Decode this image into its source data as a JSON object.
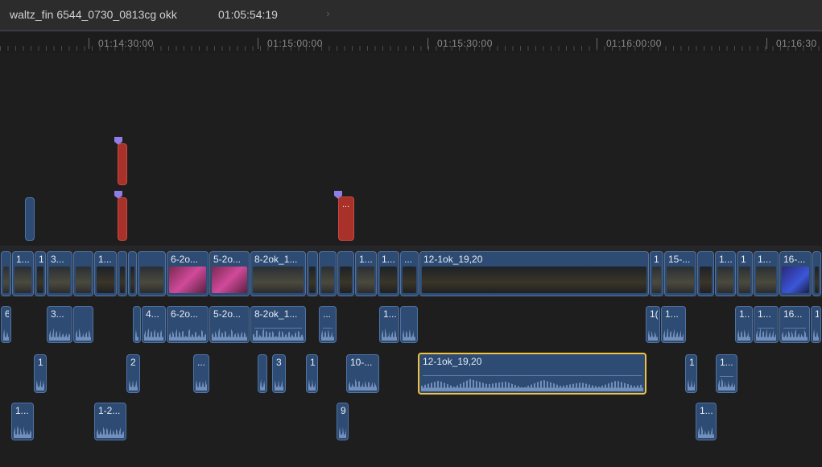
{
  "header": {
    "project_name": "waltz_fin 6544_0730_0813cg okk",
    "timecode": "01:05:54:19",
    "chevron_icon": "chevron-right-icon"
  },
  "ruler": {
    "labels": [
      "01:14:30:00",
      "01:15:00:00",
      "01:15:30:00",
      "01:16:00:00",
      "01:16:30"
    ]
  },
  "clips": {
    "c0": "",
    "c1": "1...",
    "c2": "1",
    "c3": "3...",
    "c4": "",
    "c5": "1...",
    "c6": "",
    "c7": "",
    "c8": "",
    "c9": "6-2o...",
    "c10": "5-2o...",
    "c11": "8-2ok_1...",
    "c12": "",
    "c13": "",
    "c14": "",
    "c15": "1...",
    "c16": "1...",
    "c17": "...",
    "c18": "12-1ok_19,20",
    "c19": "1",
    "c20": "15-...",
    "c21": "",
    "c22": "1...",
    "c23": "1",
    "c24": "1...",
    "c25": "16-...",
    "c26": ""
  },
  "audio_row1": {
    "a0": "6",
    "a1": "3...",
    "a2": "",
    "a3": "4...",
    "a4": "6-2o...",
    "a5": "5-2o...",
    "a6": "8-2ok_1...",
    "a7": "...",
    "a8": "1...",
    "a9": "",
    "a10": "1(",
    "a11": "1...",
    "a12": "1...",
    "a13": "1...",
    "a14": "16...",
    "a15": "1"
  },
  "audio_row2": {
    "b0": "1",
    "b1": "2",
    "b2": "...",
    "b3": "",
    "b4": "3",
    "b5": "1",
    "b6": "10-...",
    "b7": "12-1ok_19,20",
    "b8": "1",
    "b9": "1..."
  },
  "audio_row3": {
    "d0": "1...",
    "d1": "1-2...",
    "d2": "9",
    "d3": "1..."
  },
  "connected": {
    "title_clip_label": "..."
  }
}
